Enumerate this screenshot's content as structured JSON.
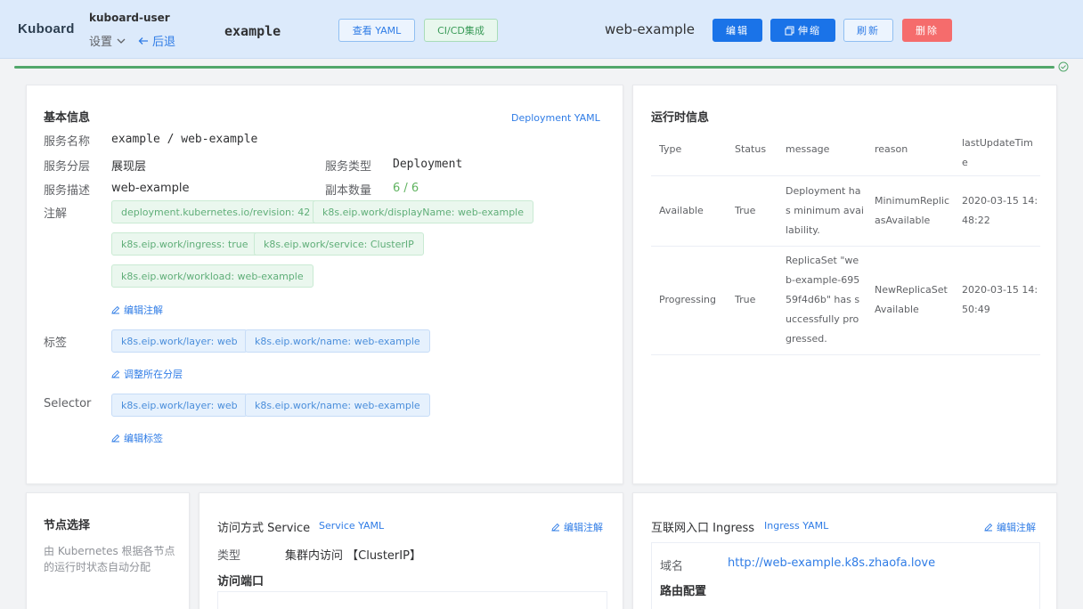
{
  "header": {
    "brand": "Kuboard",
    "user": "kuboard-user",
    "settings_label": "设置",
    "back_label": "后退",
    "namespace": "example",
    "view_yaml_label": "查看 YAML",
    "cicd_label": "CI/CD集成",
    "service_name": "web-example",
    "edit_label": "编辑",
    "scale_label": "伸缩",
    "refresh_label": "刷新",
    "delete_label": "删除"
  },
  "basic": {
    "title": "基本信息",
    "deployment_yaml_link": "Deployment YAML",
    "service_name_label": "服务名称",
    "service_name_value": "example / web-example",
    "layer_label": "服务分层",
    "layer_value": "展现层",
    "type_label": "服务类型",
    "type_value": "Deployment",
    "desc_label": "服务描述",
    "desc_value": "web-example",
    "replicas_label": "副本数量",
    "replicas_value": "6 / 6",
    "annotations_label": "注解",
    "annotations": [
      "deployment.kubernetes.io/revision: 42",
      "k8s.eip.work/displayName: web-example",
      "k8s.eip.work/ingress: true",
      "k8s.eip.work/service: ClusterIP",
      "k8s.eip.work/workload: web-example"
    ],
    "edit_annotations_label": "编辑注解",
    "labels_label": "标签",
    "labels": [
      "k8s.eip.work/layer: web",
      "k8s.eip.work/name: web-example"
    ],
    "adjust_layer_label": "调整所在分层",
    "selector_label": "Selector",
    "selectors": [
      "k8s.eip.work/layer: web",
      "k8s.eip.work/name: web-example"
    ],
    "edit_labels_label": "编辑标签"
  },
  "runtime": {
    "title": "运行时信息",
    "columns": [
      "Type",
      "Status",
      "message",
      "reason",
      "lastUpdateTime"
    ],
    "header_lines": {
      "type": "Type",
      "status": "Status",
      "message": "message",
      "reason": "reason",
      "last_update_1": "lastUpdateTim",
      "last_update_2": "e"
    },
    "rows": [
      {
        "type": "Available",
        "status": "True",
        "message_lines": [
          "Deployment ha",
          "s minimum avai",
          "lability."
        ],
        "reason_lines": [
          "MinimumReplic",
          "asAvailable"
        ],
        "time_lines": [
          "2020-03-15 14:",
          "48:22"
        ]
      },
      {
        "type": "Progressing",
        "status": "True",
        "message_lines": [
          "ReplicaSet \"we",
          "b-example-695",
          "59f4d6b\" has s",
          "uccessfully pro",
          "gressed."
        ],
        "reason_lines": [
          "NewReplicaSet",
          "Available"
        ],
        "time_lines": [
          "2020-03-15 14:",
          "50:49"
        ]
      }
    ]
  },
  "node": {
    "title": "节点选择",
    "desc_line1": "由 Kubernetes 根据各节点",
    "desc_line2": "的运行时状态自动分配"
  },
  "service": {
    "title": "访问方式 Service",
    "yaml_link": "Service YAML",
    "edit_annotations_label": "编辑注解",
    "type_label": "类型",
    "type_value": "集群内访问 【ClusterIP】",
    "ports_label": "访问端口"
  },
  "ingress": {
    "title": "互联网入口 Ingress",
    "yaml_link": "Ingress YAML",
    "edit_annotations_label": "编辑注解",
    "domain_label": "域名",
    "domain_value": "http://web-example.k8s.zhaofa.love",
    "route_label": "路由配置"
  },
  "colors": {
    "header_bg": "#dceafb",
    "primary": "#1a73e8",
    "danger": "#f56c6c",
    "success": "#52a76b",
    "link": "#2f7ce6"
  },
  "progress": {
    "percent": 100
  }
}
